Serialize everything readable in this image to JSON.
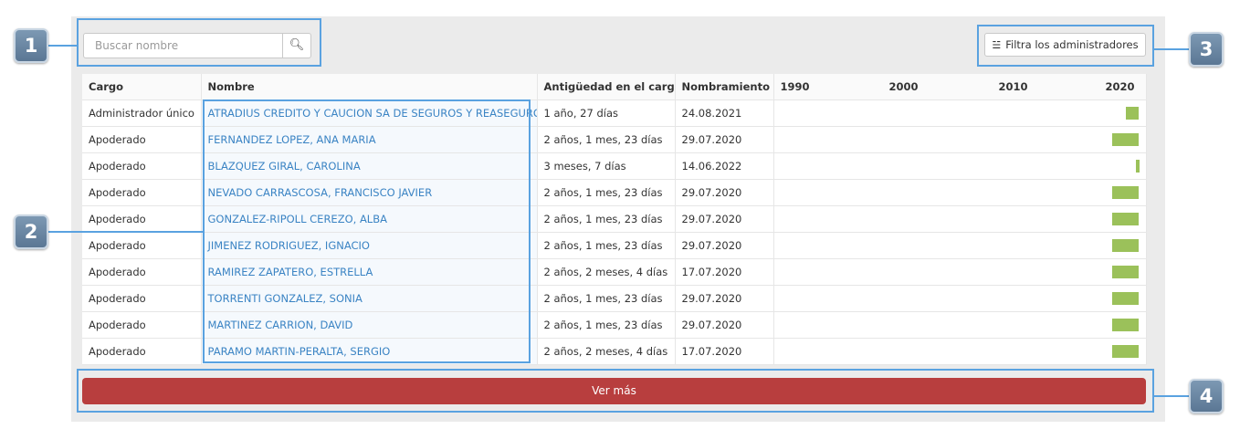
{
  "search": {
    "placeholder": "Buscar nombre",
    "icon": "search-icon"
  },
  "filter_button": {
    "label": "Filtra los administradores",
    "icon": "sliders-icon"
  },
  "table": {
    "headers": [
      "Cargo",
      "Nombre",
      "Antigüedad en el cargo",
      "Nombramiento"
    ],
    "years": [
      "1990",
      "2000",
      "2010",
      "2020"
    ],
    "rows": [
      {
        "cargo": "Administrador único",
        "nombre": "ATRADIUS CREDITO Y CAUCION SA DE SEGUROS Y REASEGUROS",
        "antiguedad": "1 año, 27 días",
        "nombramiento": "24.08.2021",
        "tenure_years": 1.07
      },
      {
        "cargo": "Apoderado",
        "nombre": "FERNANDEZ LOPEZ, ANA MARIA",
        "antiguedad": "2 años, 1 mes, 23 días",
        "nombramiento": "29.07.2020",
        "tenure_years": 2.15
      },
      {
        "cargo": "Apoderado",
        "nombre": "BLAZQUEZ GIRAL, CAROLINA",
        "antiguedad": "3 meses, 7 días",
        "nombramiento": "14.06.2022",
        "tenure_years": 0.27
      },
      {
        "cargo": "Apoderado",
        "nombre": "NEVADO CARRASCOSA, FRANCISCO JAVIER",
        "antiguedad": "2 años, 1 mes, 23 días",
        "nombramiento": "29.07.2020",
        "tenure_years": 2.15
      },
      {
        "cargo": "Apoderado",
        "nombre": "GONZALEZ-RIPOLL CEREZO, ALBA",
        "antiguedad": "2 años, 1 mes, 23 días",
        "nombramiento": "29.07.2020",
        "tenure_years": 2.15
      },
      {
        "cargo": "Apoderado",
        "nombre": "JIMENEZ RODRIGUEZ, IGNACIO",
        "antiguedad": "2 años, 1 mes, 23 días",
        "nombramiento": "29.07.2020",
        "tenure_years": 2.15
      },
      {
        "cargo": "Apoderado",
        "nombre": "RAMIREZ ZAPATERO, ESTRELLA",
        "antiguedad": "2 años, 2 meses, 4 días",
        "nombramiento": "17.07.2020",
        "tenure_years": 2.18
      },
      {
        "cargo": "Apoderado",
        "nombre": "TORRENTI GONZALEZ, SONIA",
        "antiguedad": "2 años, 1 mes, 23 días",
        "nombramiento": "29.07.2020",
        "tenure_years": 2.15
      },
      {
        "cargo": "Apoderado",
        "nombre": "MARTINEZ CARRION, DAVID",
        "antiguedad": "2 años, 1 mes, 23 días",
        "nombramiento": "29.07.2020",
        "tenure_years": 2.15
      },
      {
        "cargo": "Apoderado",
        "nombre": "PARAMO MARTIN-PERALTA, SERGIO",
        "antiguedad": "2 años, 2 meses, 4 días",
        "nombramiento": "17.07.2020",
        "tenure_years": 2.18
      }
    ]
  },
  "more_button": {
    "label": "Ver más"
  },
  "callouts": [
    "1",
    "2",
    "3",
    "4"
  ],
  "colors": {
    "link": "#3b84c4",
    "bar": "#9bc15a",
    "more_button": "#b83e3e",
    "highlight": "#5aa2e0",
    "badge": "#6a86a2"
  }
}
